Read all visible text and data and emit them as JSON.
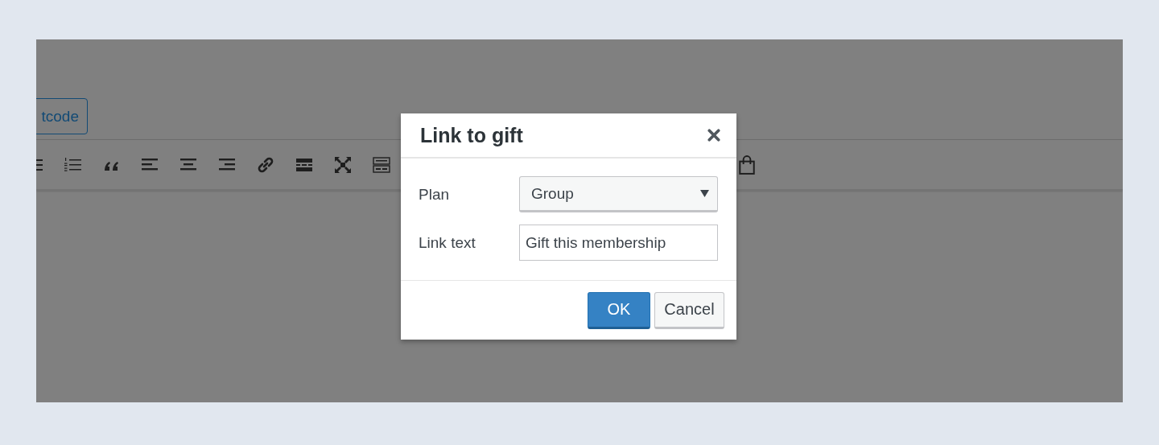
{
  "editor": {
    "shortcode_button": "tcode"
  },
  "dialog": {
    "title": "Link to gift",
    "fields": [
      {
        "kind": "select",
        "label": "Plan",
        "value": "Group"
      },
      {
        "kind": "text",
        "label": "Link text",
        "value": "Gift this membership"
      }
    ],
    "buttons": [
      {
        "kind": "primary",
        "label": "OK"
      },
      {
        "kind": "secondary",
        "label": "Cancel"
      }
    ]
  }
}
